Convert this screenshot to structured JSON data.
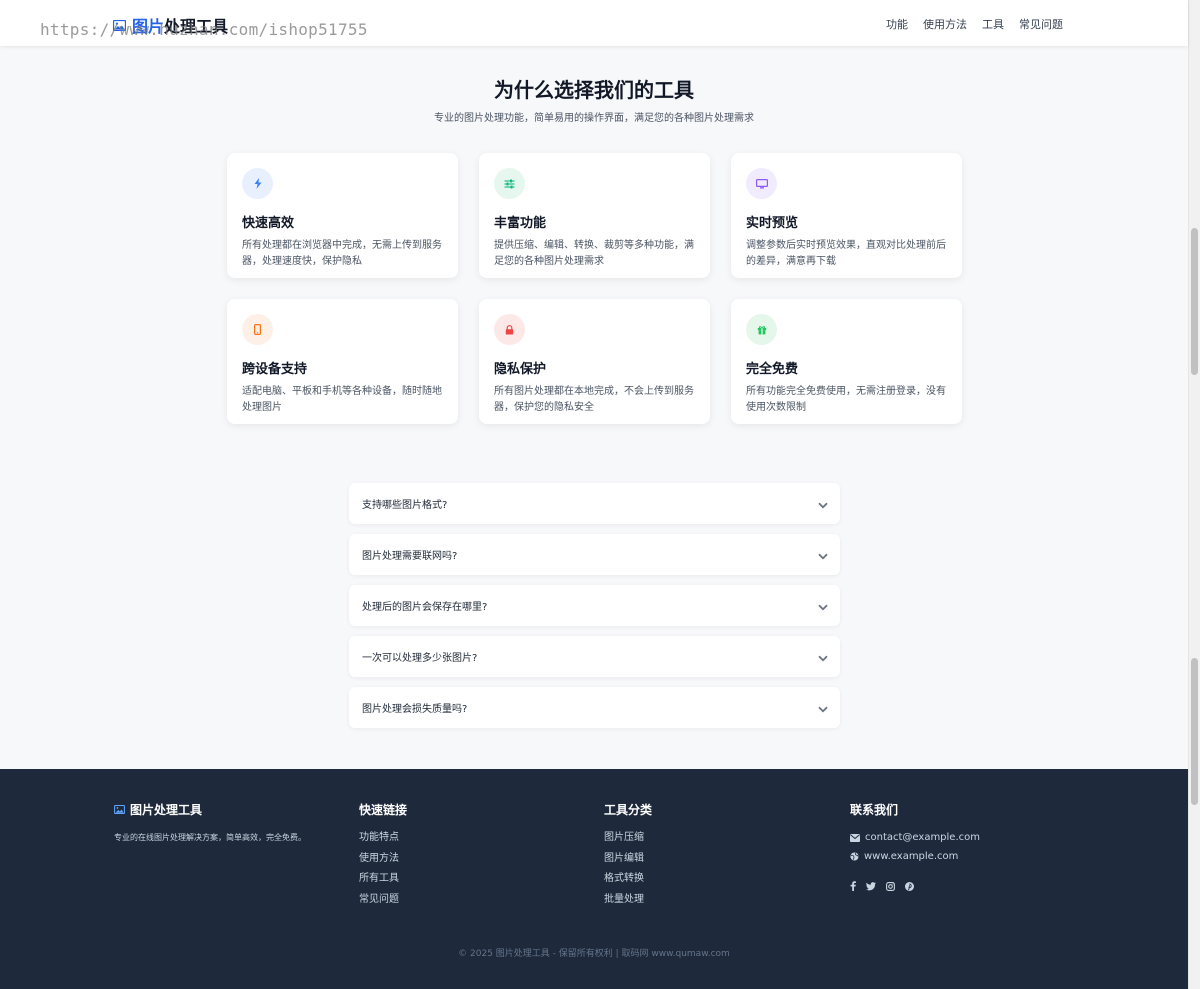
{
  "header": {
    "brand_accent": "图片",
    "brand_rest": "处理工具",
    "watermark": "https://www.huzhan.com/ishop51755",
    "nav": [
      "功能",
      "使用方法",
      "工具",
      "常见问题"
    ]
  },
  "features": {
    "title": "为什么选择我们的工具",
    "subtitle": "专业的图片处理功能，简单易用的操作界面，满足您的各种图片处理需求",
    "cards": [
      {
        "title": "快速高效",
        "desc": "所有处理都在浏览器中完成，无需上传到服务器，处理速度快，保护隐私",
        "icon": "bolt-icon",
        "icon_color": "#3b82f6",
        "icon_bg": "#e8f0fe"
      },
      {
        "title": "丰富功能",
        "desc": "提供压缩、编辑、转换、裁剪等多种功能，满足您的各种图片处理需求",
        "icon": "sliders-icon",
        "icon_color": "#10b981",
        "icon_bg": "#e6f7ef"
      },
      {
        "title": "实时预览",
        "desc": "调整参数后实时预览效果，直观对比处理前后的差异，满意再下载",
        "icon": "monitor-icon",
        "icon_color": "#8b5cf6",
        "icon_bg": "#f1ebfe"
      },
      {
        "title": "跨设备支持",
        "desc": "适配电脑、平板和手机等各种设备，随时随地处理图片",
        "icon": "mobile-icon",
        "icon_color": "#f97316",
        "icon_bg": "#fef0e7"
      },
      {
        "title": "隐私保护",
        "desc": "所有图片处理都在本地完成，不会上传到服务器，保护您的隐私安全",
        "icon": "lock-icon",
        "icon_color": "#ef4444",
        "icon_bg": "#fde8e8"
      },
      {
        "title": "完全免费",
        "desc": "所有功能完全免费使用，无需注册登录，没有使用次数限制",
        "icon": "gift-icon",
        "icon_color": "#22c55e",
        "icon_bg": "#e5f7ea"
      }
    ]
  },
  "faq": [
    "支持哪些图片格式?",
    "图片处理需要联网吗?",
    "处理后的图片会保存在哪里?",
    "一次可以处理多少张图片?",
    "图片处理会损失质量吗?"
  ],
  "footer": {
    "brand": "图片处理工具",
    "brand_desc": "专业的在线图片处理解决方案，简单高效，完全免费。",
    "quick_links_title": "快速链接",
    "quick_links": [
      "功能特点",
      "使用方法",
      "所有工具",
      "常见问题"
    ],
    "tools_title": "工具分类",
    "tools": [
      "图片压缩",
      "图片编辑",
      "格式转换",
      "批量处理"
    ],
    "contact_title": "联系我们",
    "email": "contact@example.com",
    "website": "www.example.com",
    "socials": [
      "facebook-icon",
      "twitter-icon",
      "instagram-icon",
      "pinterest-icon"
    ],
    "copyright": "© 2025 图片处理工具 - 保留所有权利 | 取码网 www.qumaw.com"
  },
  "colors": {
    "accent": "#2563eb",
    "footer_bg": "#1e293b",
    "page_bg": "#f7f8fa"
  }
}
